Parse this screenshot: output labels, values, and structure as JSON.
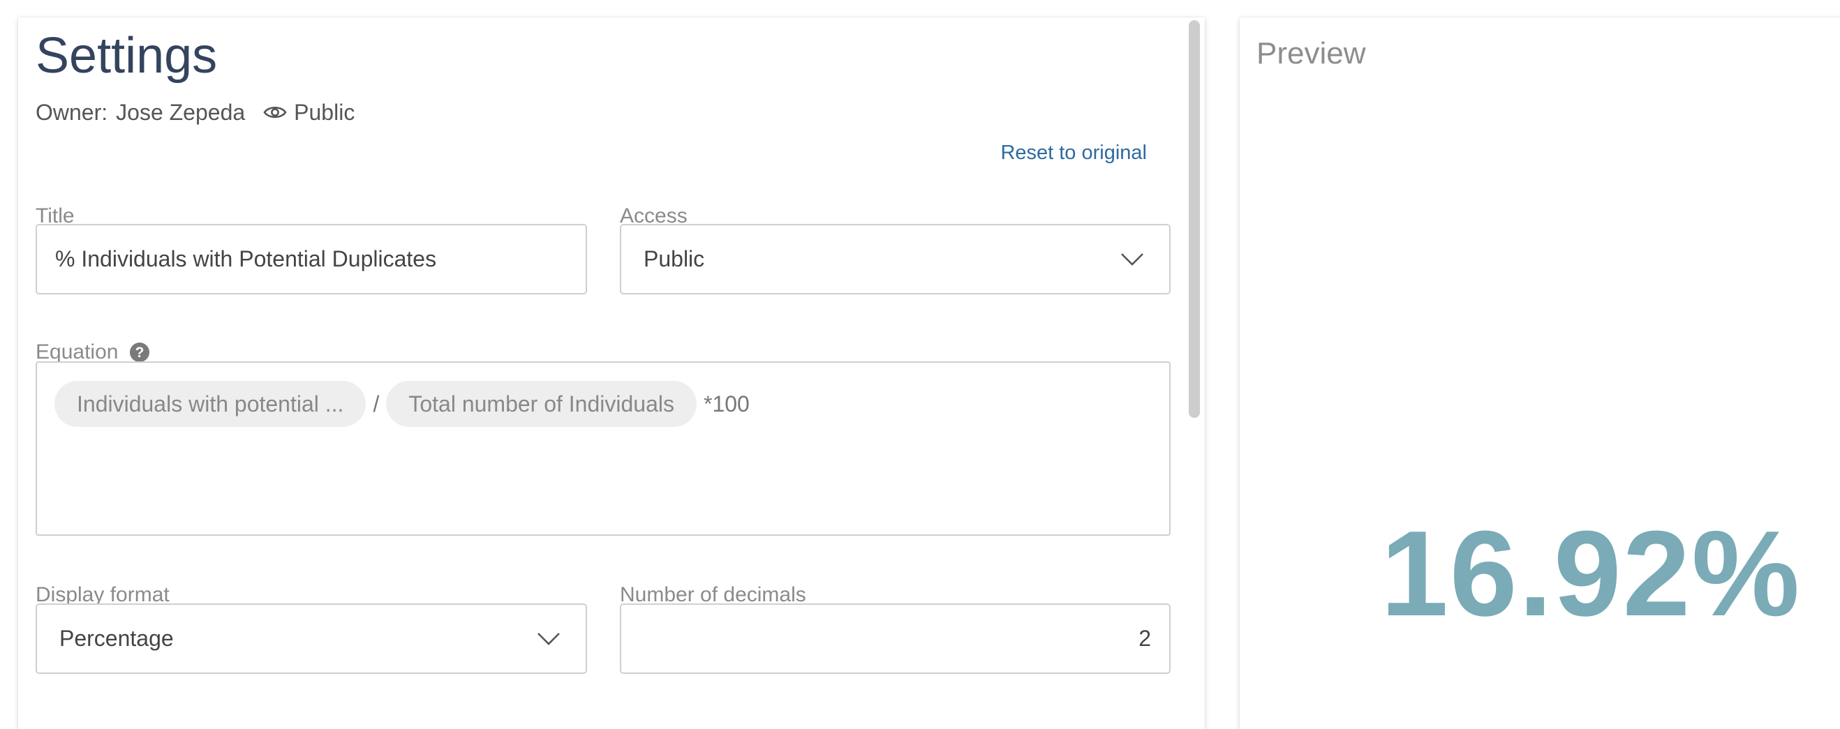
{
  "colors": {
    "heading": "#34435e",
    "link": "#2d6aa0",
    "metric": "#7aabb7",
    "label": "#8a8a8a"
  },
  "settings": {
    "heading": "Settings",
    "owner_label": "Owner:",
    "owner_name": "Jose Zepeda",
    "visibility_icon": "eye-icon",
    "visibility": "Public",
    "reset_link": "Reset to original",
    "title_label": "Title",
    "title_value": "% Individuals with Potential Duplicates",
    "access_label": "Access",
    "access_value": "Public",
    "equation_label": "Equation",
    "equation_help_icon": "help-circle-icon",
    "equation": {
      "chip_1": "Individuals with potential ...",
      "operator": "/",
      "chip_2": "Total number of Individuals",
      "suffix": "*100"
    },
    "display_format_label": "Display format",
    "display_format_value": "Percentage",
    "decimals_label": "Number of decimals",
    "decimals_value": "2"
  },
  "preview": {
    "title": "Preview",
    "metric_value": "16.92%"
  }
}
